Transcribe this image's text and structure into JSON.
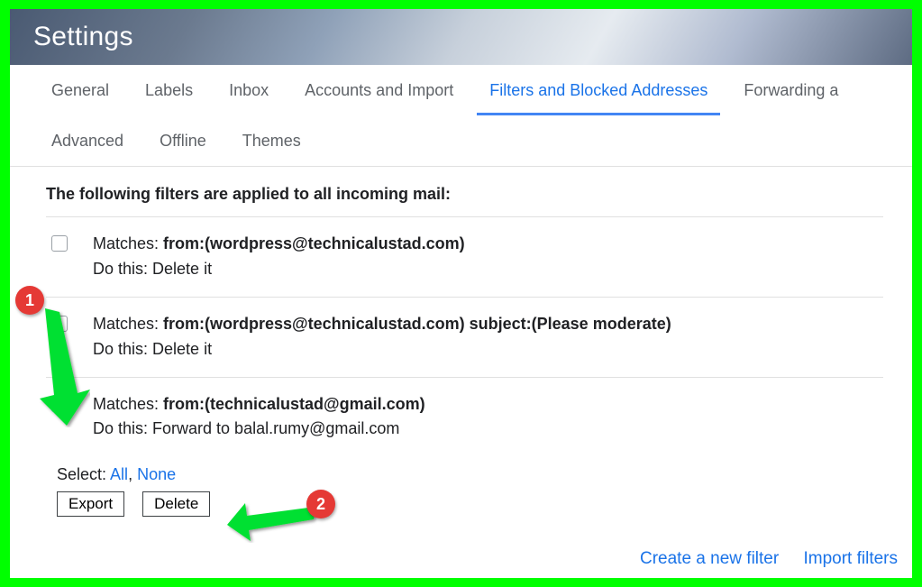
{
  "page_title": "Settings",
  "tabs_row1": [
    "General",
    "Labels",
    "Inbox",
    "Accounts and Import",
    "Filters and Blocked Addresses",
    "Forwarding a"
  ],
  "tabs_row2": [
    "Advanced",
    "Offline",
    "Themes"
  ],
  "active_tab": "Filters and Blocked Addresses",
  "intro": "The following filters are applied to all incoming mail:",
  "filters": [
    {
      "checked": false,
      "matches_label": "Matches: ",
      "matches_criteria": "from:(wordpress@technicalustad.com)",
      "action_label": "Do this: ",
      "action_text": "Delete it"
    },
    {
      "checked": false,
      "matches_label": "Matches: ",
      "matches_criteria": "from:(wordpress@technicalustad.com) subject:(Please moderate)",
      "action_label": "Do this: ",
      "action_text": "Delete it"
    },
    {
      "checked": true,
      "matches_label": "Matches: ",
      "matches_criteria": "from:(technicalustad@gmail.com)",
      "action_label": "Do this: ",
      "action_text": "Forward to balal.rumy@gmail.com"
    }
  ],
  "select_label": "Select: ",
  "select_all": "All",
  "select_sep": ", ",
  "select_none": "None",
  "buttons": {
    "export": "Export",
    "delete": "Delete"
  },
  "footer": {
    "create": "Create a new filter",
    "import": "Import filters"
  },
  "annotations": {
    "step1": "1",
    "step2": "2"
  }
}
